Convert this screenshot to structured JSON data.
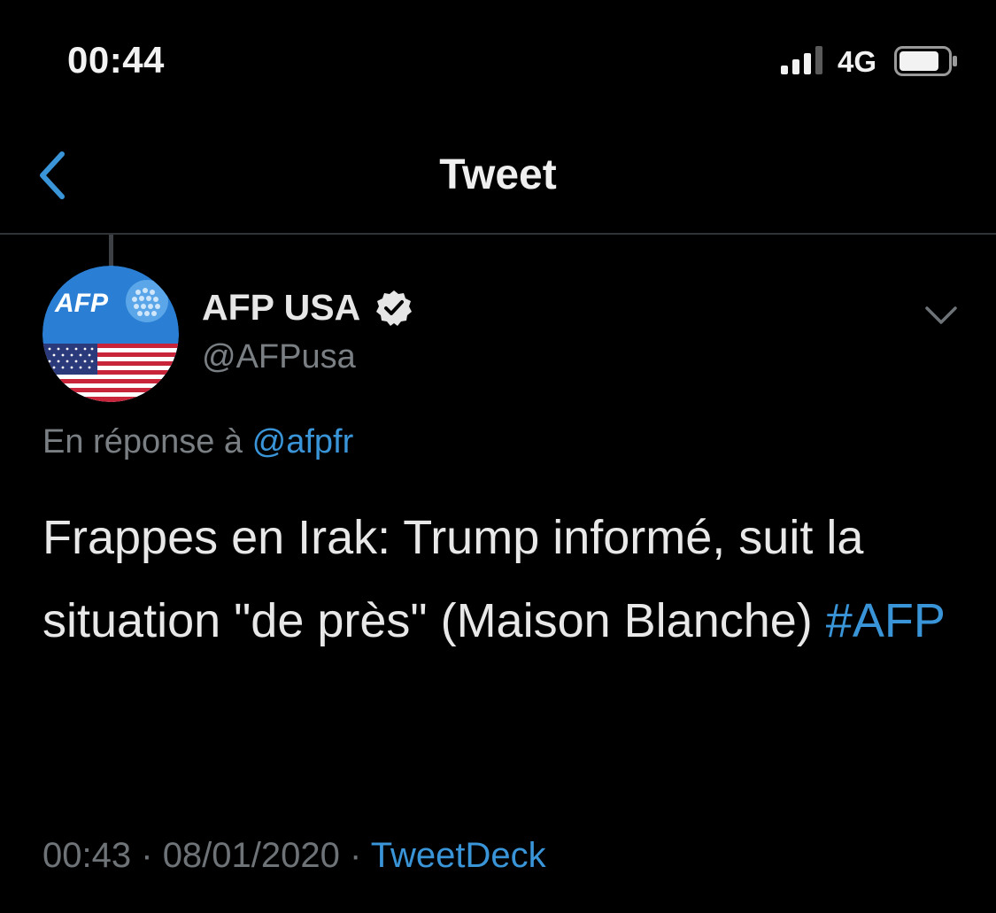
{
  "status_bar": {
    "time": "00:44",
    "network": "4G",
    "signal_icon": "cellular-signal-icon",
    "battery_icon": "battery-icon"
  },
  "nav": {
    "back_icon": "chevron-left-icon",
    "title": "Tweet"
  },
  "tweet": {
    "author": {
      "display_name": "AFP USA",
      "handle": "@AFPusa",
      "verified": true,
      "avatar_logo_text": "AFP"
    },
    "reply": {
      "prefix": "En réponse à",
      "mention": "@afpfr"
    },
    "text": "Frappes en Irak: Trump informé, suit la situation \"de près\" (Maison Blanche)",
    "hashtag": "#AFP",
    "time": "00:43",
    "separator": "·",
    "date": "08/01/2020",
    "source": "TweetDeck"
  },
  "colors": {
    "background": "#000000",
    "accent": "#3a95d8",
    "secondary_text": "#7a7f84",
    "primary_text": "#e8e8e8",
    "divider": "#2f3336"
  }
}
